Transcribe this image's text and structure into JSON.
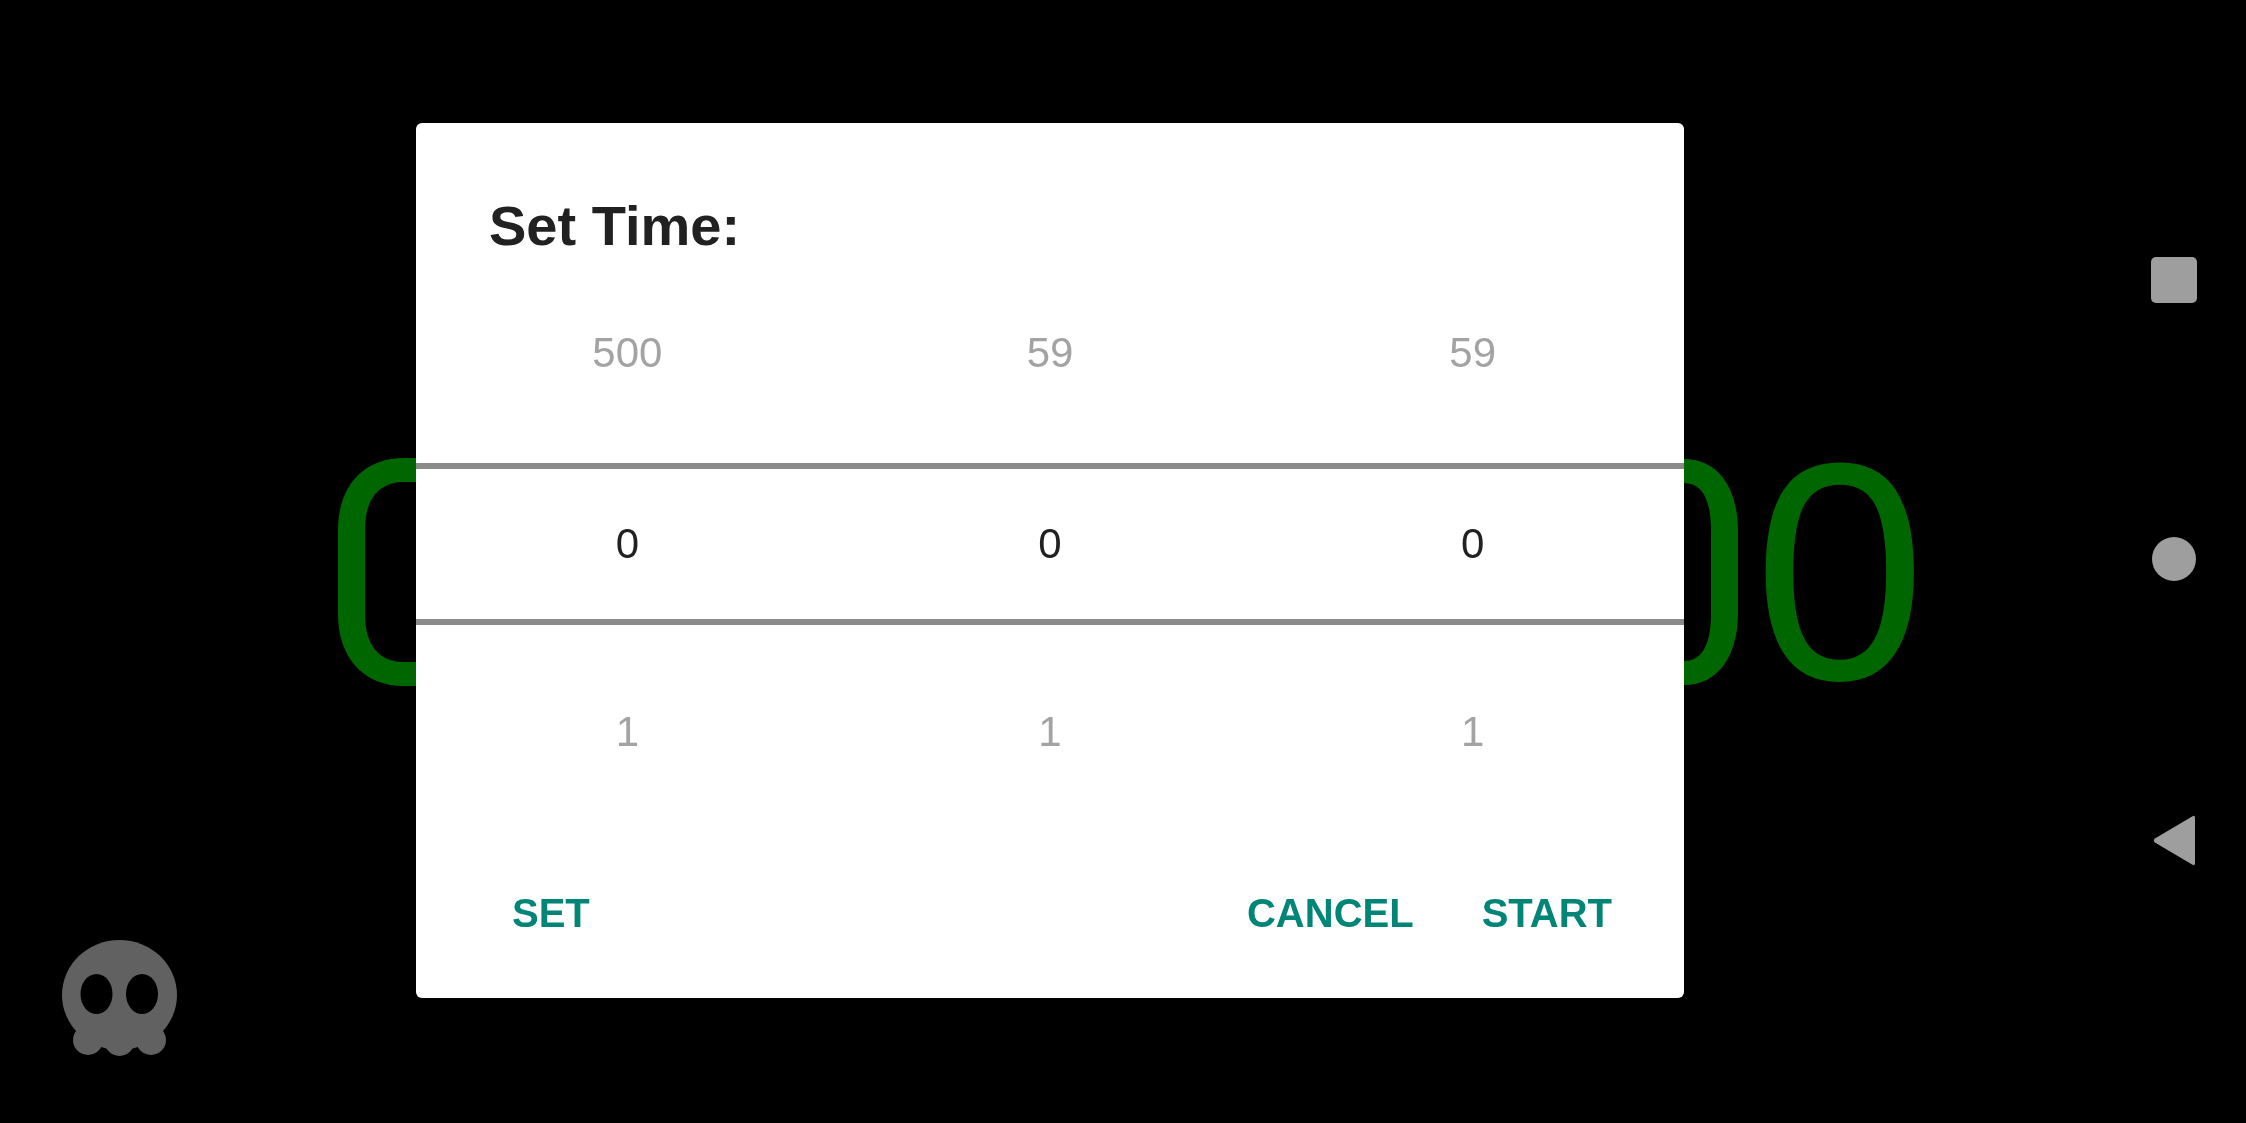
{
  "background_clock": {
    "visible_digit": "0"
  },
  "dialog": {
    "title": "Set Time:",
    "pickers": [
      {
        "above": "500",
        "value": "0",
        "below": "1"
      },
      {
        "above": "59",
        "value": "0",
        "below": "1"
      },
      {
        "above": "59",
        "value": "0",
        "below": "1"
      }
    ],
    "left_buttons": [
      "SET"
    ],
    "right_buttons": [
      "CANCEL",
      "START"
    ]
  }
}
